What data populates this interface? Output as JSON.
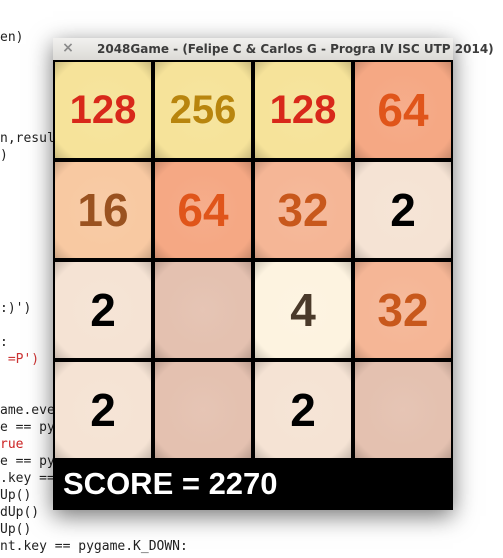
{
  "background_code": {
    "lines": [
      "en)",
      "n,resul",
      ")",
      ":)')",
      ":",
      " =P')",
      "ame.eve",
      "e == py",
      "rue",
      "e == py",
      ".key ==",
      "Up()",
      "dUp()",
      "Up()",
      "nt.key == pygame.K_DOWN:"
    ]
  },
  "window": {
    "title": "2048Game - (Felipe C & Carlos G - Progra IV ISC UTP 2014)",
    "close_glyph": "×"
  },
  "board": {
    "rows": [
      [
        {
          "value": "128",
          "bg": "#f6e39a",
          "fg": "#d8281a"
        },
        {
          "value": "256",
          "bg": "#f6e39a",
          "fg": "#b8850e"
        },
        {
          "value": "128",
          "bg": "#f6e39a",
          "fg": "#d8281a"
        },
        {
          "value": "64",
          "bg": "#f5a884",
          "fg": "#e0551a"
        }
      ],
      [
        {
          "value": "16",
          "bg": "#f8c9a2",
          "fg": "#9a5220"
        },
        {
          "value": "64",
          "bg": "#f5a884",
          "fg": "#e0551a"
        },
        {
          "value": "32",
          "bg": "#f5b696",
          "fg": "#c8581c"
        },
        {
          "value": "2",
          "bg": "#f5e3d4",
          "fg": "#000000"
        }
      ],
      [
        {
          "value": "2",
          "bg": "#f5e3d4",
          "fg": "#000000"
        },
        {
          "value": "",
          "bg": "#e4c1b0",
          "fg": "#000000"
        },
        {
          "value": "4",
          "bg": "#fdf3e0",
          "fg": "#4a3a2a"
        },
        {
          "value": "32",
          "bg": "#f5b696",
          "fg": "#c8581c"
        }
      ],
      [
        {
          "value": "2",
          "bg": "#f5e3d4",
          "fg": "#000000"
        },
        {
          "value": "",
          "bg": "#e4c1b0",
          "fg": "#000000"
        },
        {
          "value": "2",
          "bg": "#f5e3d4",
          "fg": "#000000"
        },
        {
          "value": "",
          "bg": "#e4c1b0",
          "fg": "#000000"
        }
      ]
    ]
  },
  "score": {
    "label": "SCORE = 2270"
  }
}
